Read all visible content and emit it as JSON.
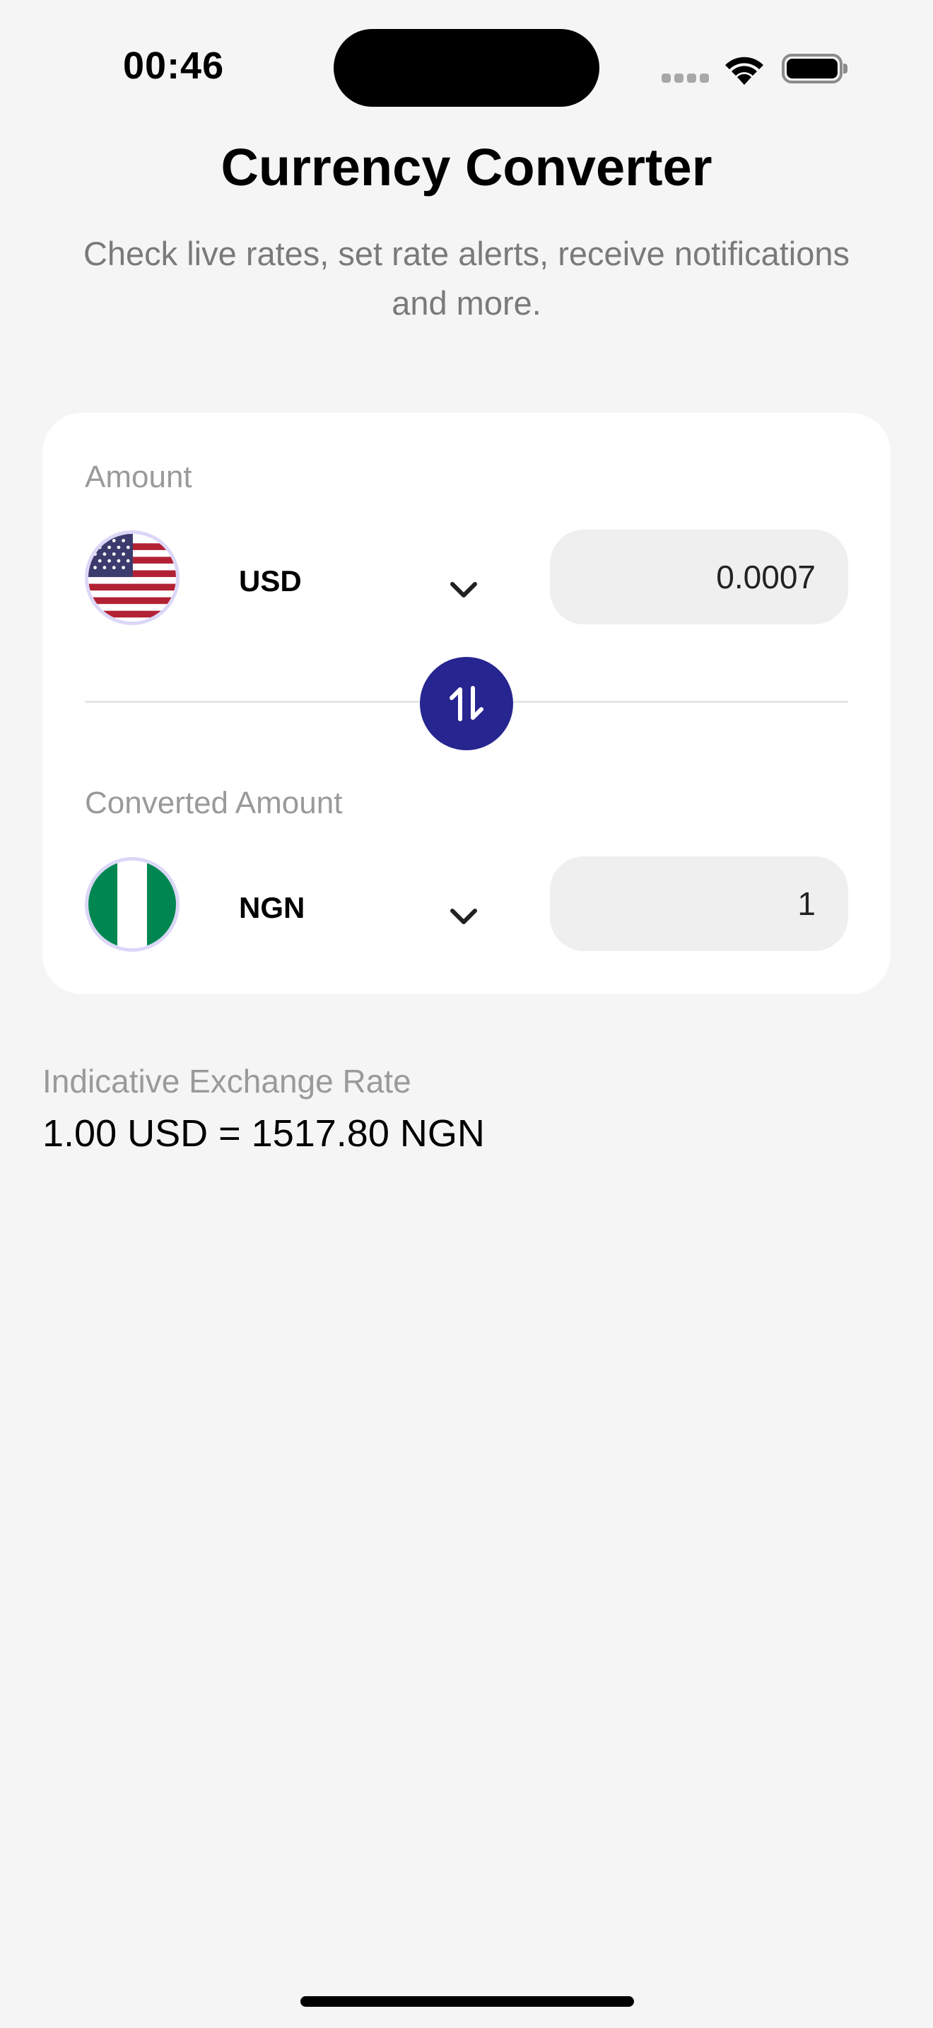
{
  "status_bar": {
    "time": "00:46",
    "icons": [
      "cellular-signal-icon",
      "wifi-icon",
      "battery-icon"
    ]
  },
  "header": {
    "title": "Currency Converter",
    "subtitle": "Check live rates, set rate alerts, receive notifications and more."
  },
  "converter": {
    "from": {
      "label": "Amount",
      "currency": "USD",
      "flag_icon": "us-flag-icon",
      "value": "0.0007"
    },
    "to": {
      "label": "Converted Amount",
      "currency": "NGN",
      "flag_icon": "nigeria-flag-icon",
      "value": "1"
    },
    "swap_icon": "swap-arrows-icon"
  },
  "rate": {
    "label": "Indicative Exchange Rate",
    "value": "1.00 USD = 1517.80 NGN"
  },
  "colors": {
    "background": "#f5f5f5",
    "card": "#ffffff",
    "accent": "#27258f",
    "input_bg": "#efefef",
    "muted_text": "#9a9a9a",
    "flag_ring": "#dcd7f7",
    "nigeria_green": "#008751",
    "us_red": "#b22234",
    "us_blue": "#3c3b6e"
  }
}
